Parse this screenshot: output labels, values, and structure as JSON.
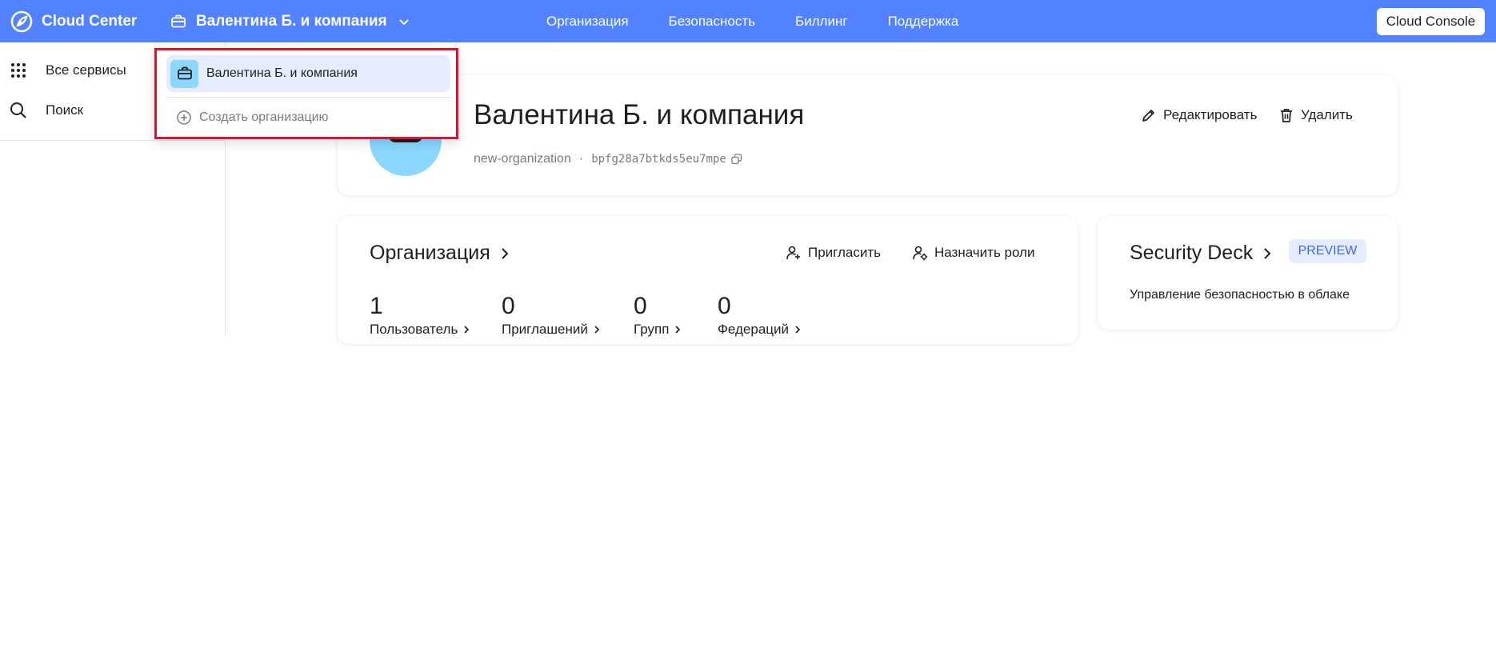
{
  "header": {
    "brand": "Cloud Center",
    "org_switch": "Валентина Б. и компания",
    "nav": [
      "Организация",
      "Безопасность",
      "Биллинг",
      "Поддержка"
    ],
    "console_button": "Cloud Console"
  },
  "sidebar": {
    "items": [
      {
        "label": "Все сервисы",
        "icon": "grid-icon"
      },
      {
        "label": "Поиск",
        "icon": "search-icon"
      }
    ]
  },
  "dropdown": {
    "current_org": "Валентина Б. и компания",
    "create_label": "Создать организацию"
  },
  "org_card": {
    "title": "Валентина Б. и компания",
    "slug": "new-organization",
    "separator": "·",
    "id": "bpfg28a7btkds5eu7mpe",
    "edit_label": "Редактировать",
    "delete_label": "Удалить"
  },
  "organization_section": {
    "title": "Организация",
    "invite_label": "Пригласить",
    "assign_roles_label": "Назначить роли",
    "stats": [
      {
        "value": "1",
        "label": "Пользователь"
      },
      {
        "value": "0",
        "label": "Приглашений"
      },
      {
        "value": "0",
        "label": "Групп"
      },
      {
        "value": "0",
        "label": "Федераций"
      }
    ]
  },
  "security_deck": {
    "title": "Security Deck",
    "badge": "PREVIEW",
    "description": "Управление безопасностью в облаке"
  },
  "colors": {
    "header_bg": "#5282ff",
    "accent_light": "#e6ecff",
    "avatar": "#8ad7ff",
    "highlight_border": "#e0102f"
  }
}
